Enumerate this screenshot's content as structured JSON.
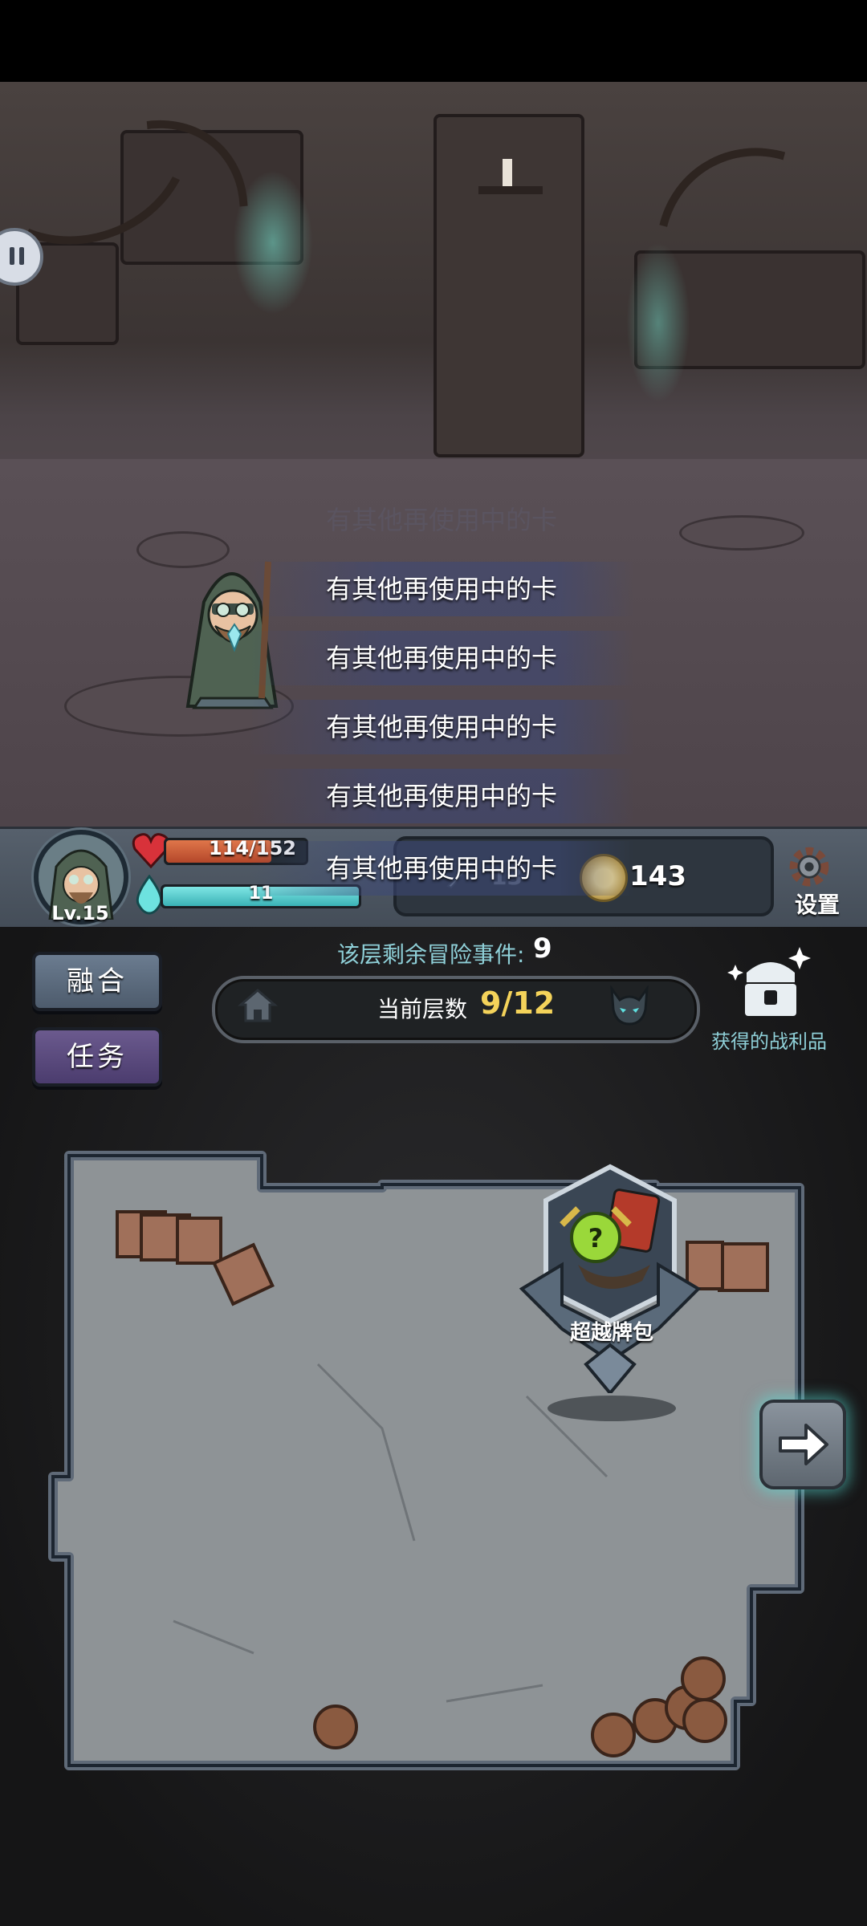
{
  "hud": {
    "level": "Lv.15",
    "hp_text": "114/152",
    "hp_fraction": 0.75,
    "mp_text": "11",
    "mp_fraction": 1.0,
    "sword_value": "13",
    "coins": "143",
    "settings_label": "设置"
  },
  "toasts": [
    {
      "text": "有其他再使用中的卡"
    },
    {
      "text": "有其他再使用中的卡"
    },
    {
      "text": "有其他再使用中的卡"
    },
    {
      "text": "有其他再使用中的卡"
    },
    {
      "text": "有其他再使用中的卡"
    },
    {
      "text": "有其他再使用中的卡"
    }
  ],
  "panel": {
    "fuse_label": "融合",
    "quest_label": "任务",
    "events_label": "该层剩余冒险事件:",
    "events_value": "9",
    "floor_label": "当前层数",
    "floor_value": "9/12",
    "loot_label": "获得的战利品"
  },
  "map": {
    "card_pack_label": "超越牌包"
  },
  "icons": {
    "pause": "pause-icon",
    "heart": "heart-icon",
    "drop": "mana-drop-icon",
    "coin": "coin-icon",
    "settings": "gear-icon",
    "house": "house-icon",
    "boss": "demon-head-icon",
    "loot": "treasure-chest-icon",
    "next": "arrow-right-icon"
  },
  "colors": {
    "accent_cyan": "#8fd0d8",
    "floor_gold": "#f4d35a",
    "hp_red": "#c9573a",
    "mp_teal": "#4fc4c6"
  }
}
